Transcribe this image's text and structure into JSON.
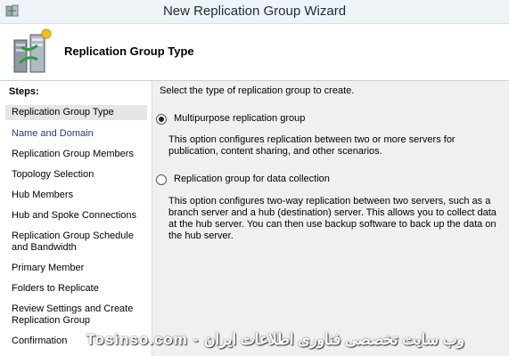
{
  "window": {
    "title": "New Replication Group Wizard",
    "app_icon": "wizard-app-icon"
  },
  "header": {
    "heading": "Replication Group Type",
    "icon": "replication-servers-icon"
  },
  "sidebar": {
    "steps_label": "Steps:",
    "steps": [
      {
        "label": "Replication Group Type",
        "state": "current"
      },
      {
        "label": "Name and Domain",
        "state": "link"
      },
      {
        "label": "Replication Group Members",
        "state": "normal"
      },
      {
        "label": "Topology Selection",
        "state": "normal"
      },
      {
        "label": "Hub Members",
        "state": "normal"
      },
      {
        "label": "Hub and Spoke Connections",
        "state": "normal"
      },
      {
        "label": "Replication Group Schedule and Bandwidth",
        "state": "normal"
      },
      {
        "label": "Primary Member",
        "state": "normal"
      },
      {
        "label": "Folders to Replicate",
        "state": "normal"
      },
      {
        "label": "Review Settings and Create Replication Group",
        "state": "normal"
      },
      {
        "label": "Confirmation",
        "state": "normal"
      }
    ]
  },
  "content": {
    "prompt": "Select the type of replication group to create.",
    "options": [
      {
        "label": "Multipurpose replication group",
        "selected": true,
        "description": "This option configures replication between two or more servers for publication, content sharing, and other scenarios."
      },
      {
        "label": "Replication group for data collection",
        "selected": false,
        "description": "This option configures two-way replication between two servers, such as a branch server and a hub (destination) server. This allows you to collect data at the hub server. You can then use backup software to back up the data on the hub server."
      }
    ]
  },
  "watermark": "Tosinso.com - وب سایت تخصصی فناوری اطلاعات ایران"
}
